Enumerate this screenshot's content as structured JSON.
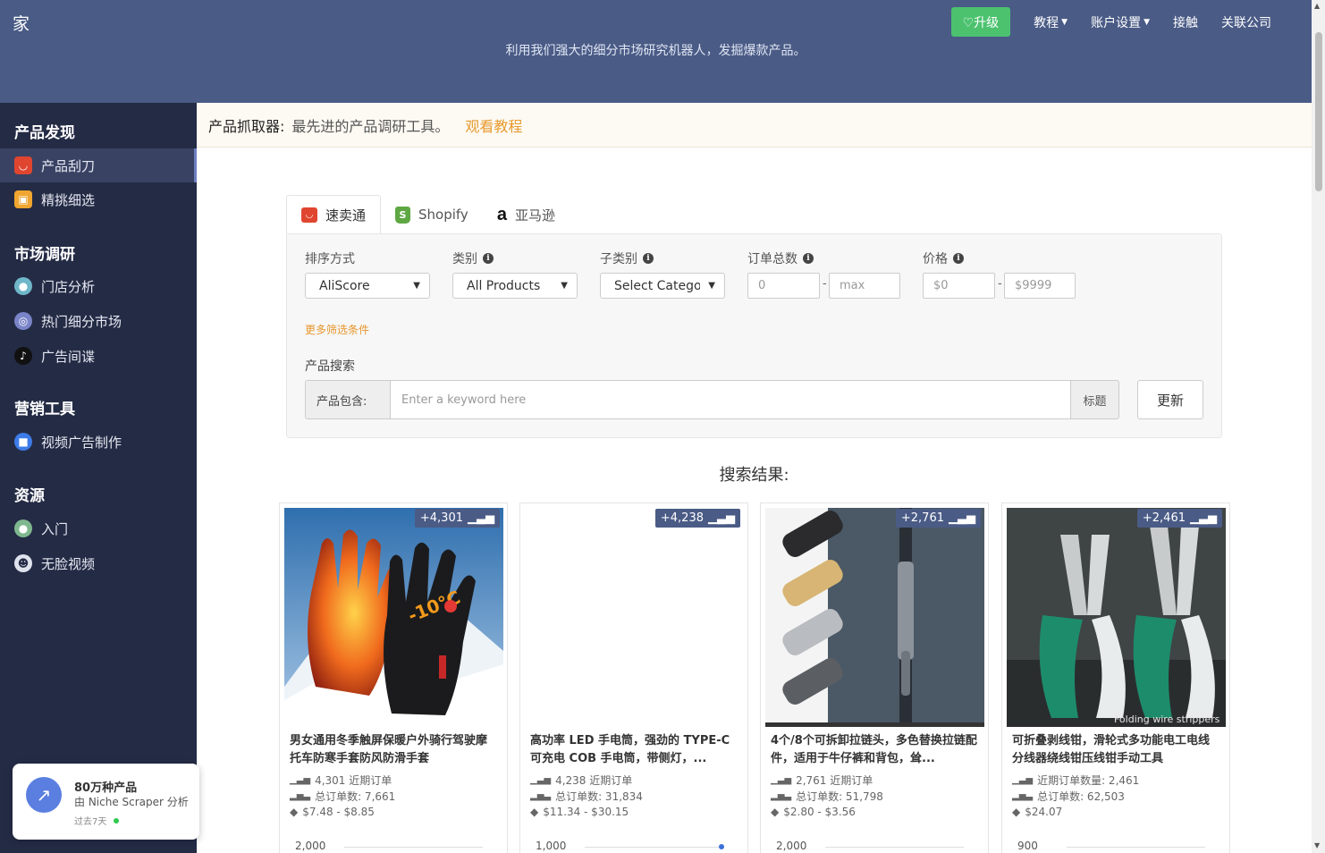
{
  "header": {
    "brand": "家",
    "subtitle": "利用我们强大的细分市场研究机器人，发掘爆款产品。",
    "upgrade": "♡升级",
    "nav": [
      "教程",
      "账户设置",
      "接触",
      "关联公司"
    ]
  },
  "sidebar": {
    "sections": [
      {
        "title": "产品发现",
        "items": [
          "产品刮刀",
          "精挑细选"
        ]
      },
      {
        "title": "市场调研",
        "items": [
          "门店分析",
          "热门细分市场",
          "广告间谍"
        ]
      },
      {
        "title": "营销工具",
        "items": [
          "视频广告制作"
        ]
      },
      {
        "title": "资源",
        "items": [
          "入门",
          "无脸视频"
        ]
      }
    ],
    "promo": {
      "title": "80万种产品",
      "by": "由 Niche Scraper 分析",
      "period": "过去7天"
    }
  },
  "banner": {
    "label": "产品抓取器:",
    "desc": "最先进的产品调研工具。",
    "link": "观看教程"
  },
  "tabs": [
    "速卖通",
    "Shopify",
    "亚马逊"
  ],
  "filters": {
    "sort_label": "排序方式",
    "sort_value": "AliScore",
    "category_label": "类别",
    "category_value": "All Products",
    "subcategory_label": "子类别",
    "subcategory_value": "Select Category",
    "orders_label": "订单总数",
    "orders_min": "0",
    "orders_max": "max",
    "price_label": "价格",
    "price_min": "$0",
    "price_max": "$9999",
    "more": "更多筛选条件",
    "search_label": "产品搜索",
    "contains": "产品包含:",
    "keyword_placeholder": "Enter a keyword here",
    "title_btn": "标题",
    "update_btn": "更新"
  },
  "results_title": "搜索结果:",
  "products": [
    {
      "badge": "+4,301",
      "title": "男女通用冬季触屏保暖户外骑行驾驶摩托车防寒手套防风防滑手套",
      "recent": "4,301 近期订单",
      "total": "总订单数: 7,661",
      "price": "$7.48 - $8.85",
      "axis": "2,000"
    },
    {
      "badge": "+4,238",
      "title": "高功率 LED 手电筒，强劲的 TYPE-C 可充电 COB 手电筒，带侧灯，...",
      "recent": "4,238 近期订单",
      "total": "总订单数: 31,834",
      "price": "$11.34 - $30.15",
      "axis": "1,000"
    },
    {
      "badge": "+2,761",
      "title": "4个/8个可拆卸拉链头，多色替换拉链配件，适用于牛仔裤和背包，耸...",
      "recent": "2,761 近期订单",
      "total": "总订单数: 51,798",
      "price": "$2.80 - $3.56",
      "axis": "2,000"
    },
    {
      "badge": "+2,461",
      "title": "可折叠剥线钳，滑轮式多功能电工电线分线器绕线钳压线钳手动工具",
      "recent": "近期订单数量: 2,461",
      "total": "总订单数: 62,503",
      "price": "$24.07",
      "axis": "900",
      "img_caption": "Folding wire strippers"
    }
  ]
}
